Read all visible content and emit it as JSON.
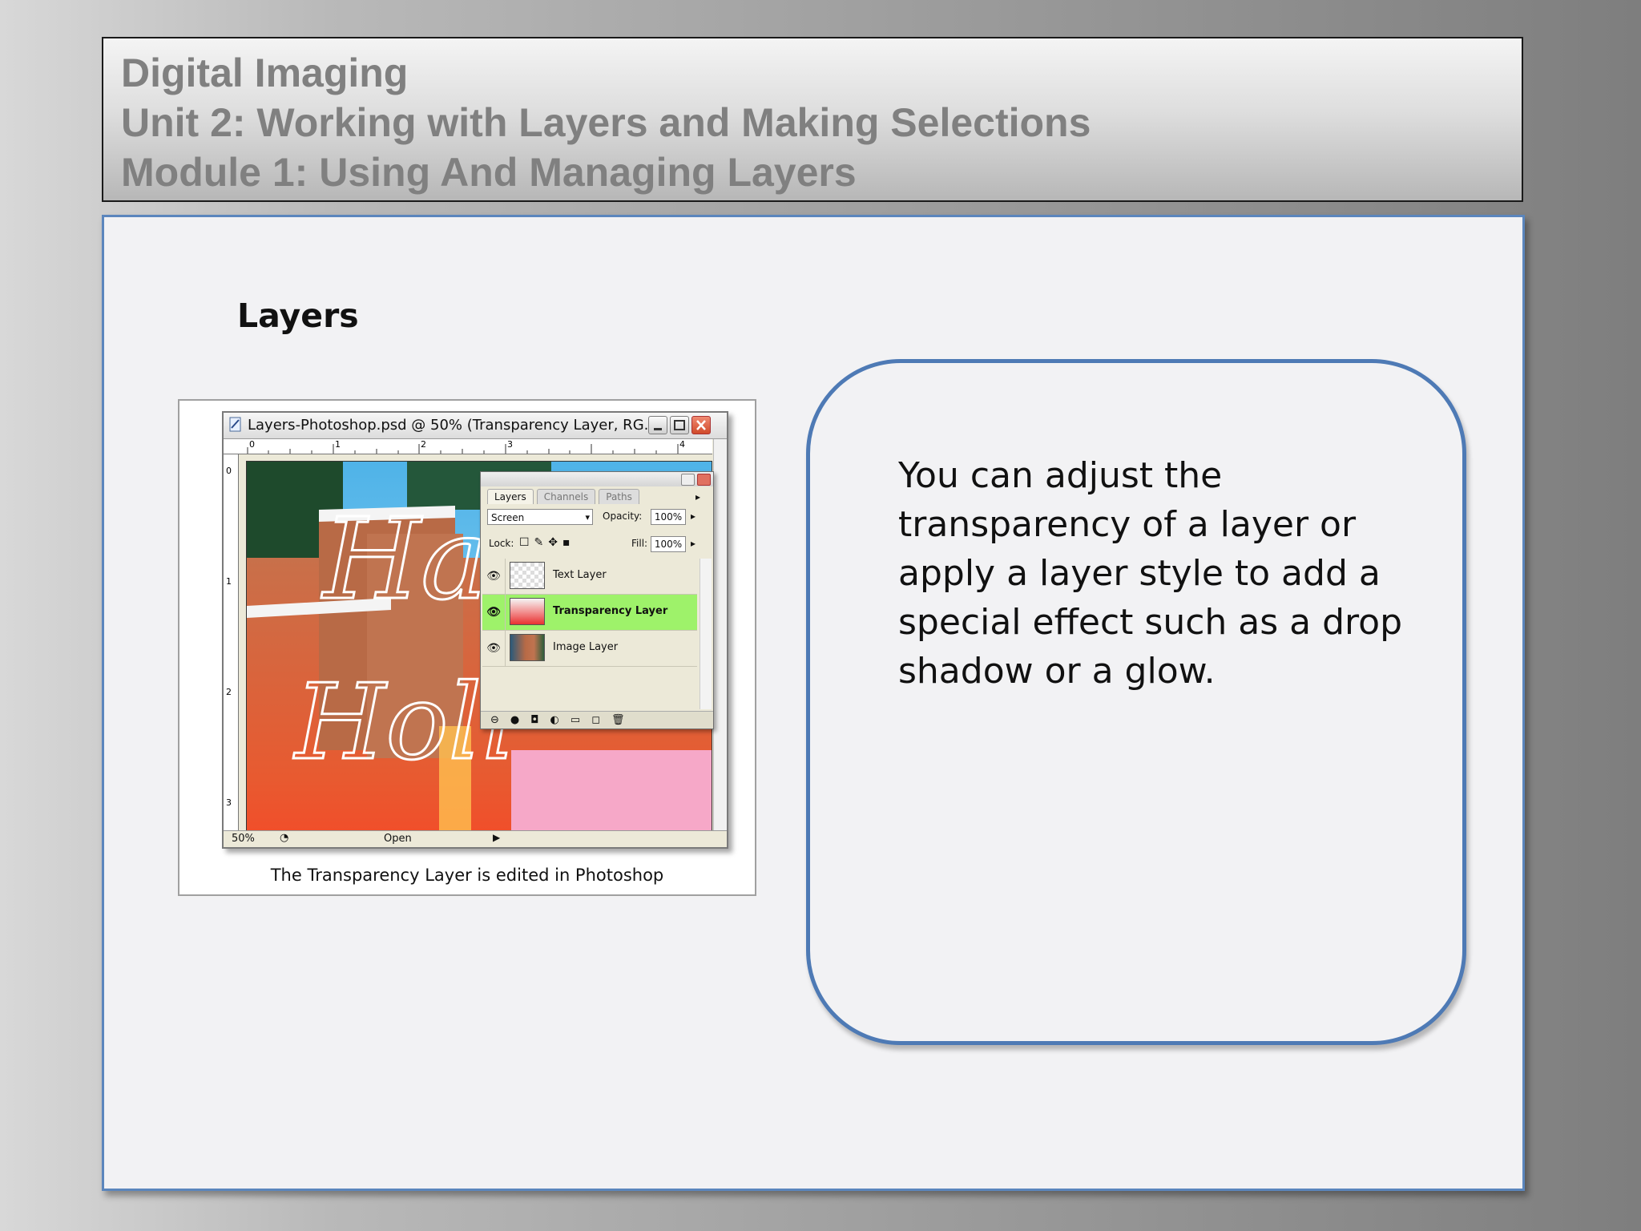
{
  "header": {
    "course": "Digital Imaging",
    "unit": "Unit 2: Working with Layers and Making Selections",
    "module": "Module 1: Using And Managing Layers"
  },
  "slide": {
    "heading": "Layers",
    "caption": "The Transparency Layer is edited in Photoshop",
    "callout_text": "You can adjust the transparency of a layer or apply a layer style to add a special effect such as a drop shadow or a glow."
  },
  "photoshop_window": {
    "title": "Layers-Photoshop.psd @ 50% (Transparency Layer, RG...",
    "ruler_top": [
      "0",
      "1",
      "2",
      "3",
      "4"
    ],
    "ruler_left": [
      "0",
      "1",
      "2",
      "3"
    ],
    "status_zoom": "50%",
    "status_text": "Open",
    "canvas_script_text": "Ha",
    "canvas_script_text2": "Holi",
    "layers_panel": {
      "tabs": [
        "Layers",
        "Channels",
        "Paths"
      ],
      "active_tab": "Layers",
      "blend_mode": "Screen",
      "opacity_label": "Opacity:",
      "opacity_value": "100%",
      "lock_label": "Lock:",
      "fill_label": "Fill:",
      "fill_value": "100%",
      "layers": [
        {
          "name": "Text Layer",
          "selected": false,
          "visible": true
        },
        {
          "name": "Transparency Layer",
          "selected": true,
          "visible": true
        },
        {
          "name": "Image Layer",
          "selected": false,
          "visible": true
        }
      ],
      "bottom_icons": [
        "link-icon",
        "style-icon",
        "mask-icon",
        "adjustment-icon",
        "folder-icon",
        "new-layer-icon",
        "trash-icon"
      ]
    }
  },
  "colors": {
    "panel_border": "#5b86bd",
    "callout_border": "#4e7ab5",
    "header_text": "#808080",
    "selected_layer": "#9ef26a"
  }
}
